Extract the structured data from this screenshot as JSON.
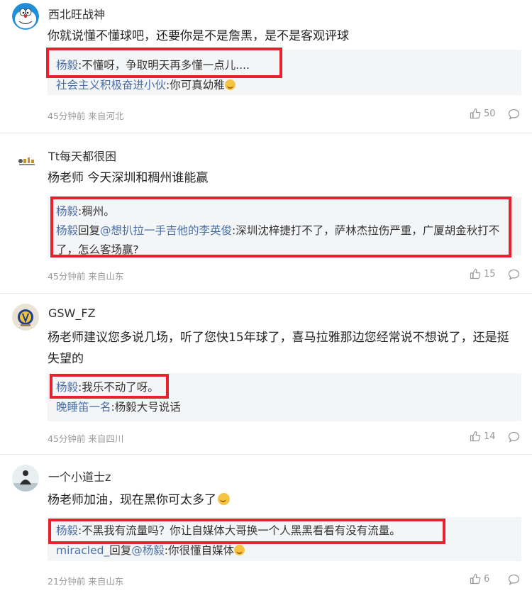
{
  "comments": [
    {
      "username": "西北旺战神",
      "avatar_icon": "doraemon-avatar-icon",
      "text": "你就说懂不懂球吧，还要你是不是詹黑，是不是客观评球",
      "replies": [
        {
          "name": "杨毅",
          "text": ":不懂呀，争取明天再多懂一点儿....",
          "highlighted": true
        },
        {
          "name": "社会主义积极奋进小伙",
          "text": ":你可真幼稚"
        }
      ],
      "meta": "45分钟前 来自河北",
      "likes": "50"
    },
    {
      "username": "Tt每天都很困",
      "avatar_icon": "cartoon-avatar-icon",
      "text": "杨老师 今天深圳和稠州谁能赢",
      "replies": [
        {
          "name": "杨毅",
          "text": ":稠州。",
          "highlighted": true
        },
        {
          "name": "杨毅",
          "reply_word": "回复",
          "target": "@想扒拉一手吉他的李英俊",
          "text": ":深圳沈梓捷打不了，萨林杰拉伤严重，广厦胡金秋打不了，怎么客场赢?",
          "highlighted": true
        }
      ],
      "meta": "45分钟前 来自山东",
      "likes": "15"
    },
    {
      "username": "GSW_FZ",
      "avatar_icon": "warriors-logo-avatar-icon",
      "text": "杨老师建议您多说几场，听了您快15年球了，喜马拉雅那边您经常说不想说了，还是挺失望的",
      "replies": [
        {
          "name": "杨毅",
          "text": ":我乐不动了呀。",
          "highlighted": true
        },
        {
          "name": "晚睡笛一名",
          "text": ":杨毅大号说话"
        }
      ],
      "meta": "45分钟前 来自四川",
      "likes": "14"
    },
    {
      "username": "一个小道士z",
      "avatar_icon": "taoist-avatar-icon",
      "text": "杨老师加油，现在黑你可太多了",
      "replies": [
        {
          "name": "杨毅",
          "text": ":不黑我有流量吗？你让自媒体大哥换一个人黑黑看看有没有流量。",
          "highlighted": true
        },
        {
          "name": "miracled_",
          "reply_word": "回复",
          "target": "@杨毅",
          "text": ":你很懂自媒体"
        }
      ],
      "meta": "21分钟前 来自山东",
      "likes": "6"
    }
  ],
  "colors": {
    "link": "#4a6fa5",
    "highlight_border": "#e6222f",
    "reply_bg": "#f4f5f7"
  }
}
